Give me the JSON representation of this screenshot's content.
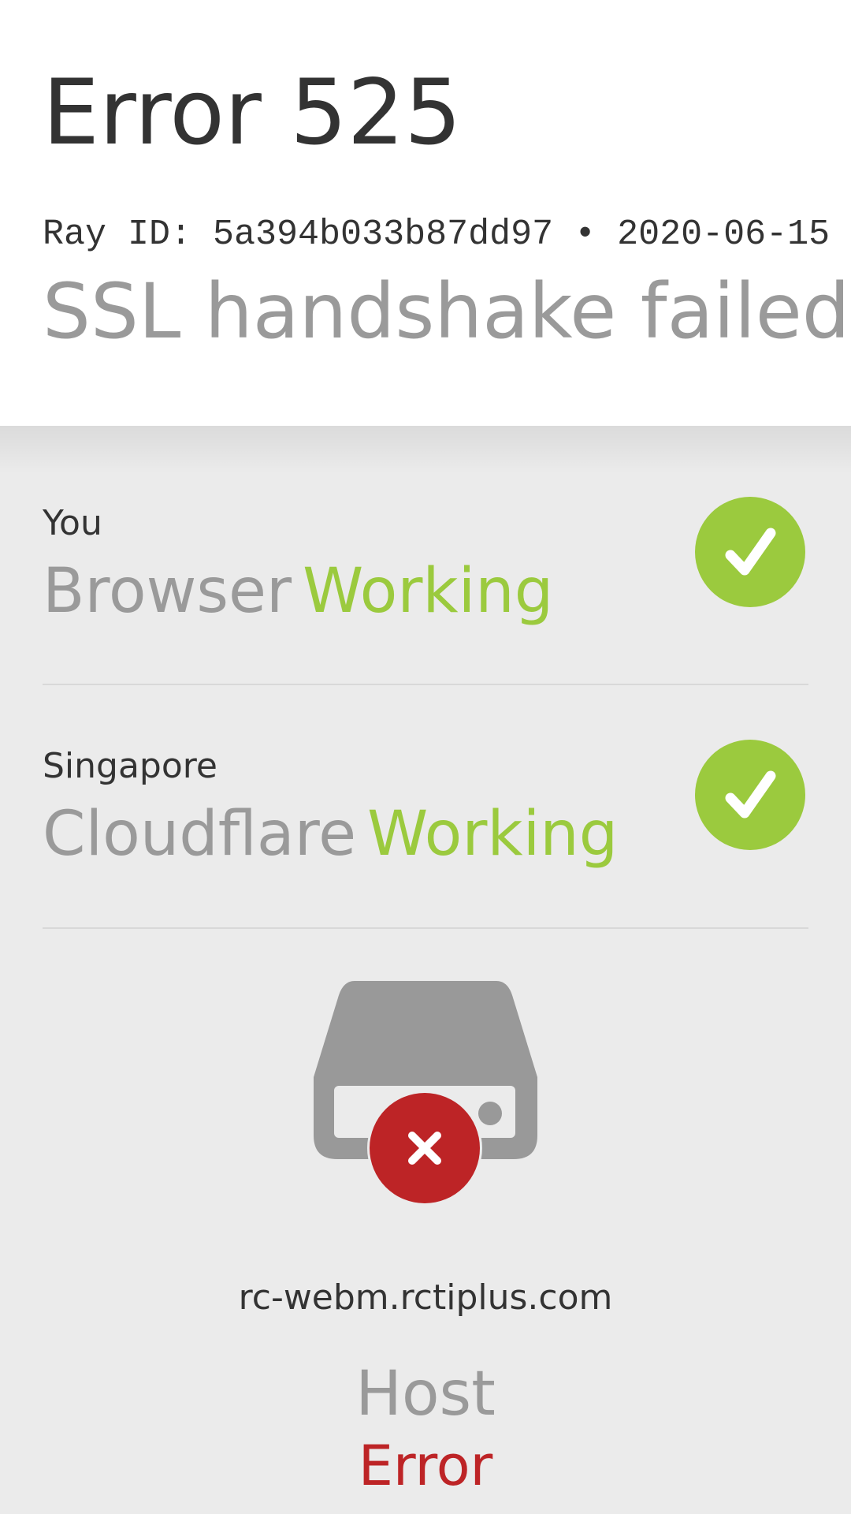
{
  "header": {
    "title": "Error 525",
    "ray_line": "Ray ID: 5a394b033b87dd97 • 2020-06-15",
    "subtitle": "SSL handshake failed"
  },
  "browser": {
    "location": "You",
    "name": "Browser",
    "status": "Working",
    "icon": "check-icon"
  },
  "cloudflare": {
    "location": "Singapore",
    "name": "Cloudflare",
    "status": "Working",
    "icon": "check-icon"
  },
  "host": {
    "hostname": "rc-webm.rctiplus.com",
    "name": "Host",
    "status": "Error",
    "icon": "server-error-icon"
  },
  "colors": {
    "working": "#9bca3e",
    "error": "#bd2426",
    "server_gray": "#999999"
  }
}
